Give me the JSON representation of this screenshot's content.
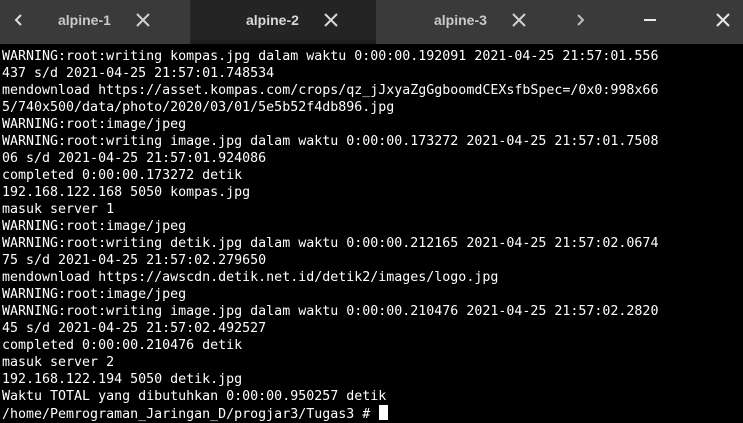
{
  "tabs": [
    {
      "label": "alpine-1",
      "active": false
    },
    {
      "label": "alpine-2",
      "active": true
    },
    {
      "label": "alpine-3",
      "active": false
    }
  ],
  "icons": {
    "nav_left": "chevron-left-icon",
    "nav_right": "chevron-right-icon",
    "tab_close": "close-icon",
    "minimize": "minimize-icon",
    "window_close": "close-icon"
  },
  "colors": {
    "tabbar_bg": "#3a3a3a",
    "active_tab_bg": "#242424",
    "terminal_bg": "#000000",
    "terminal_fg": "#ffffff"
  },
  "terminal": {
    "lines": [
      "WARNING:root:writing kompas.jpg dalam waktu 0:00:00.192091 2021-04-25 21:57:01.556",
      "437 s/d 2021-04-25 21:57:01.748534",
      "mendownload https://asset.kompas.com/crops/qz_jJxyaZgGgboomdCEXsfbSpec=/0x0:998x66",
      "5/740x500/data/photo/2020/03/01/5e5b52f4db896.jpg",
      "WARNING:root:image/jpeg",
      "WARNING:root:writing image.jpg dalam waktu 0:00:00.173272 2021-04-25 21:57:01.7508",
      "06 s/d 2021-04-25 21:57:01.924086",
      "completed 0:00:00.173272 detik",
      "192.168.122.168 5050 kompas.jpg",
      "masuk server 1",
      "WARNING:root:image/jpeg",
      "WARNING:root:writing detik.jpg dalam waktu 0:00:00.212165 2021-04-25 21:57:02.0674",
      "75 s/d 2021-04-25 21:57:02.279650",
      "mendownload https://awscdn.detik.net.id/detik2/images/logo.jpg",
      "WARNING:root:image/jpeg",
      "WARNING:root:writing image.jpg dalam waktu 0:00:00.210476 2021-04-25 21:57:02.2820",
      "45 s/d 2021-04-25 21:57:02.492527",
      "completed 0:00:00.210476 detik",
      "masuk server 2",
      "192.168.122.194 5050 detik.jpg",
      "Waktu TOTAL yang dibutuhkan 0:00:00.950257 detik"
    ],
    "prompt": "/home/Pemrograman_Jaringan_D/progjar3/Tugas3 # "
  }
}
